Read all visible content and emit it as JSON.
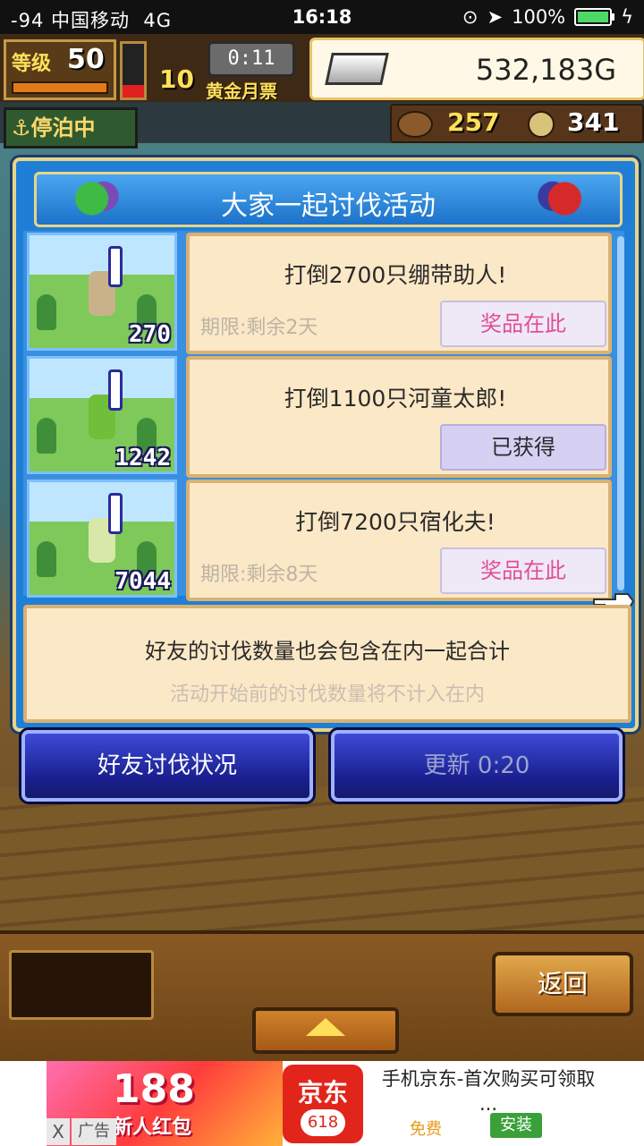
{
  "status_bar": {
    "signal": "-94",
    "carrier": "中国移动",
    "network": "4G",
    "time": "16:18",
    "battery": "100%"
  },
  "hud": {
    "level_label": "等级",
    "level": "50",
    "ticket_count": "10",
    "ticket_timer": "0:11",
    "ticket_label": "黄金月票",
    "gold": "532,183G",
    "anchored_label": "停泊中",
    "resource_1": "257",
    "resource_2": "341"
  },
  "dialog": {
    "title": "大家一起讨伐活动",
    "events": [
      {
        "thumb_count": "270",
        "title": "打倒2700只绷带助人!",
        "deadline": "期限:剩余2天",
        "button": "奖品在此",
        "state": "prize",
        "monster_color": "#c9b28a"
      },
      {
        "thumb_count": "1242",
        "title": "打倒1100只河童太郎!",
        "deadline": "",
        "button": "已获得",
        "state": "obtained",
        "monster_color": "#6fbf3a"
      },
      {
        "thumb_count": "7044",
        "title": "打倒7200只宿化夫!",
        "deadline": "期限:剩余8天",
        "button": "奖品在此",
        "state": "prize",
        "monster_color": "#d8e8a8"
      }
    ],
    "info_line1": "好友的讨伐数量也会包含在内一起合计",
    "info_line2": "活动开始前的讨伐数量将不计入在内",
    "friend_status_button": "好友讨伐状况",
    "refresh_button": "更新 0:20"
  },
  "bottom": {
    "back_button": "返回"
  },
  "ad": {
    "promo_number": "188",
    "promo_text": "新人红包",
    "close": "X",
    "label": "广告",
    "app_logo_text": "京东",
    "app_logo_sub": "618",
    "app_title": "手机京东-首次购买可领取 ...",
    "free": "免费",
    "install": "安装"
  }
}
